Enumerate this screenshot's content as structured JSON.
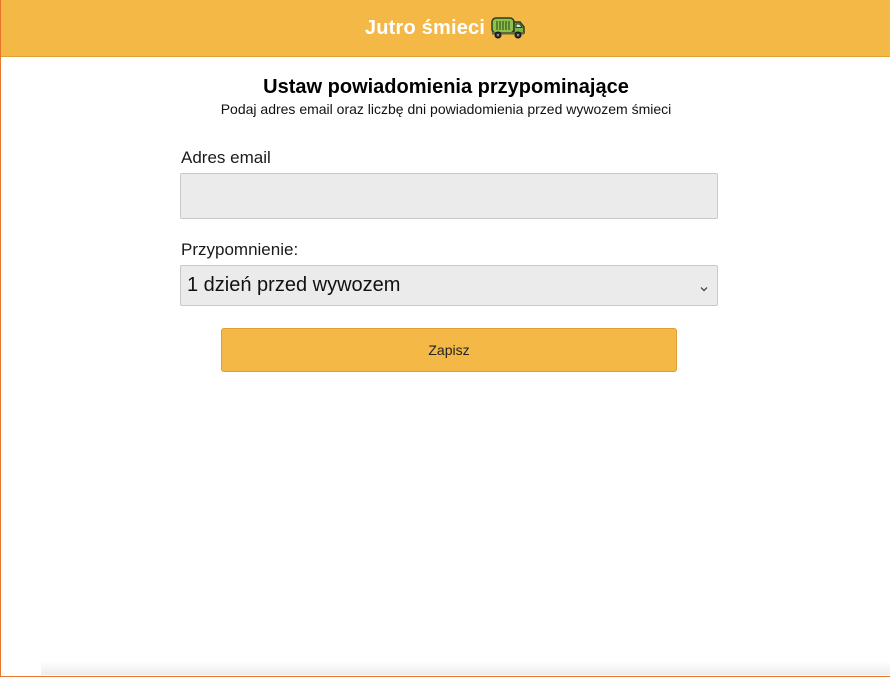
{
  "header": {
    "title": "Jutro śmieci",
    "icon": "garbage-truck-icon"
  },
  "main": {
    "title": "Ustaw powiadomienia przypominające",
    "subtitle": "Podaj adres email oraz liczbę dni powiadomienia przed wywozem śmieci"
  },
  "form": {
    "email_label": "Adres email",
    "email_value": "",
    "email_placeholder": "",
    "reminder_label": "Przypomnienie:",
    "reminder_selected": "1 dzień przed wywozem",
    "save_label": "Zapisz"
  },
  "colors": {
    "accent": "#f3b846",
    "input_bg": "#ebebeb",
    "truck_body": "#8bc34a"
  }
}
